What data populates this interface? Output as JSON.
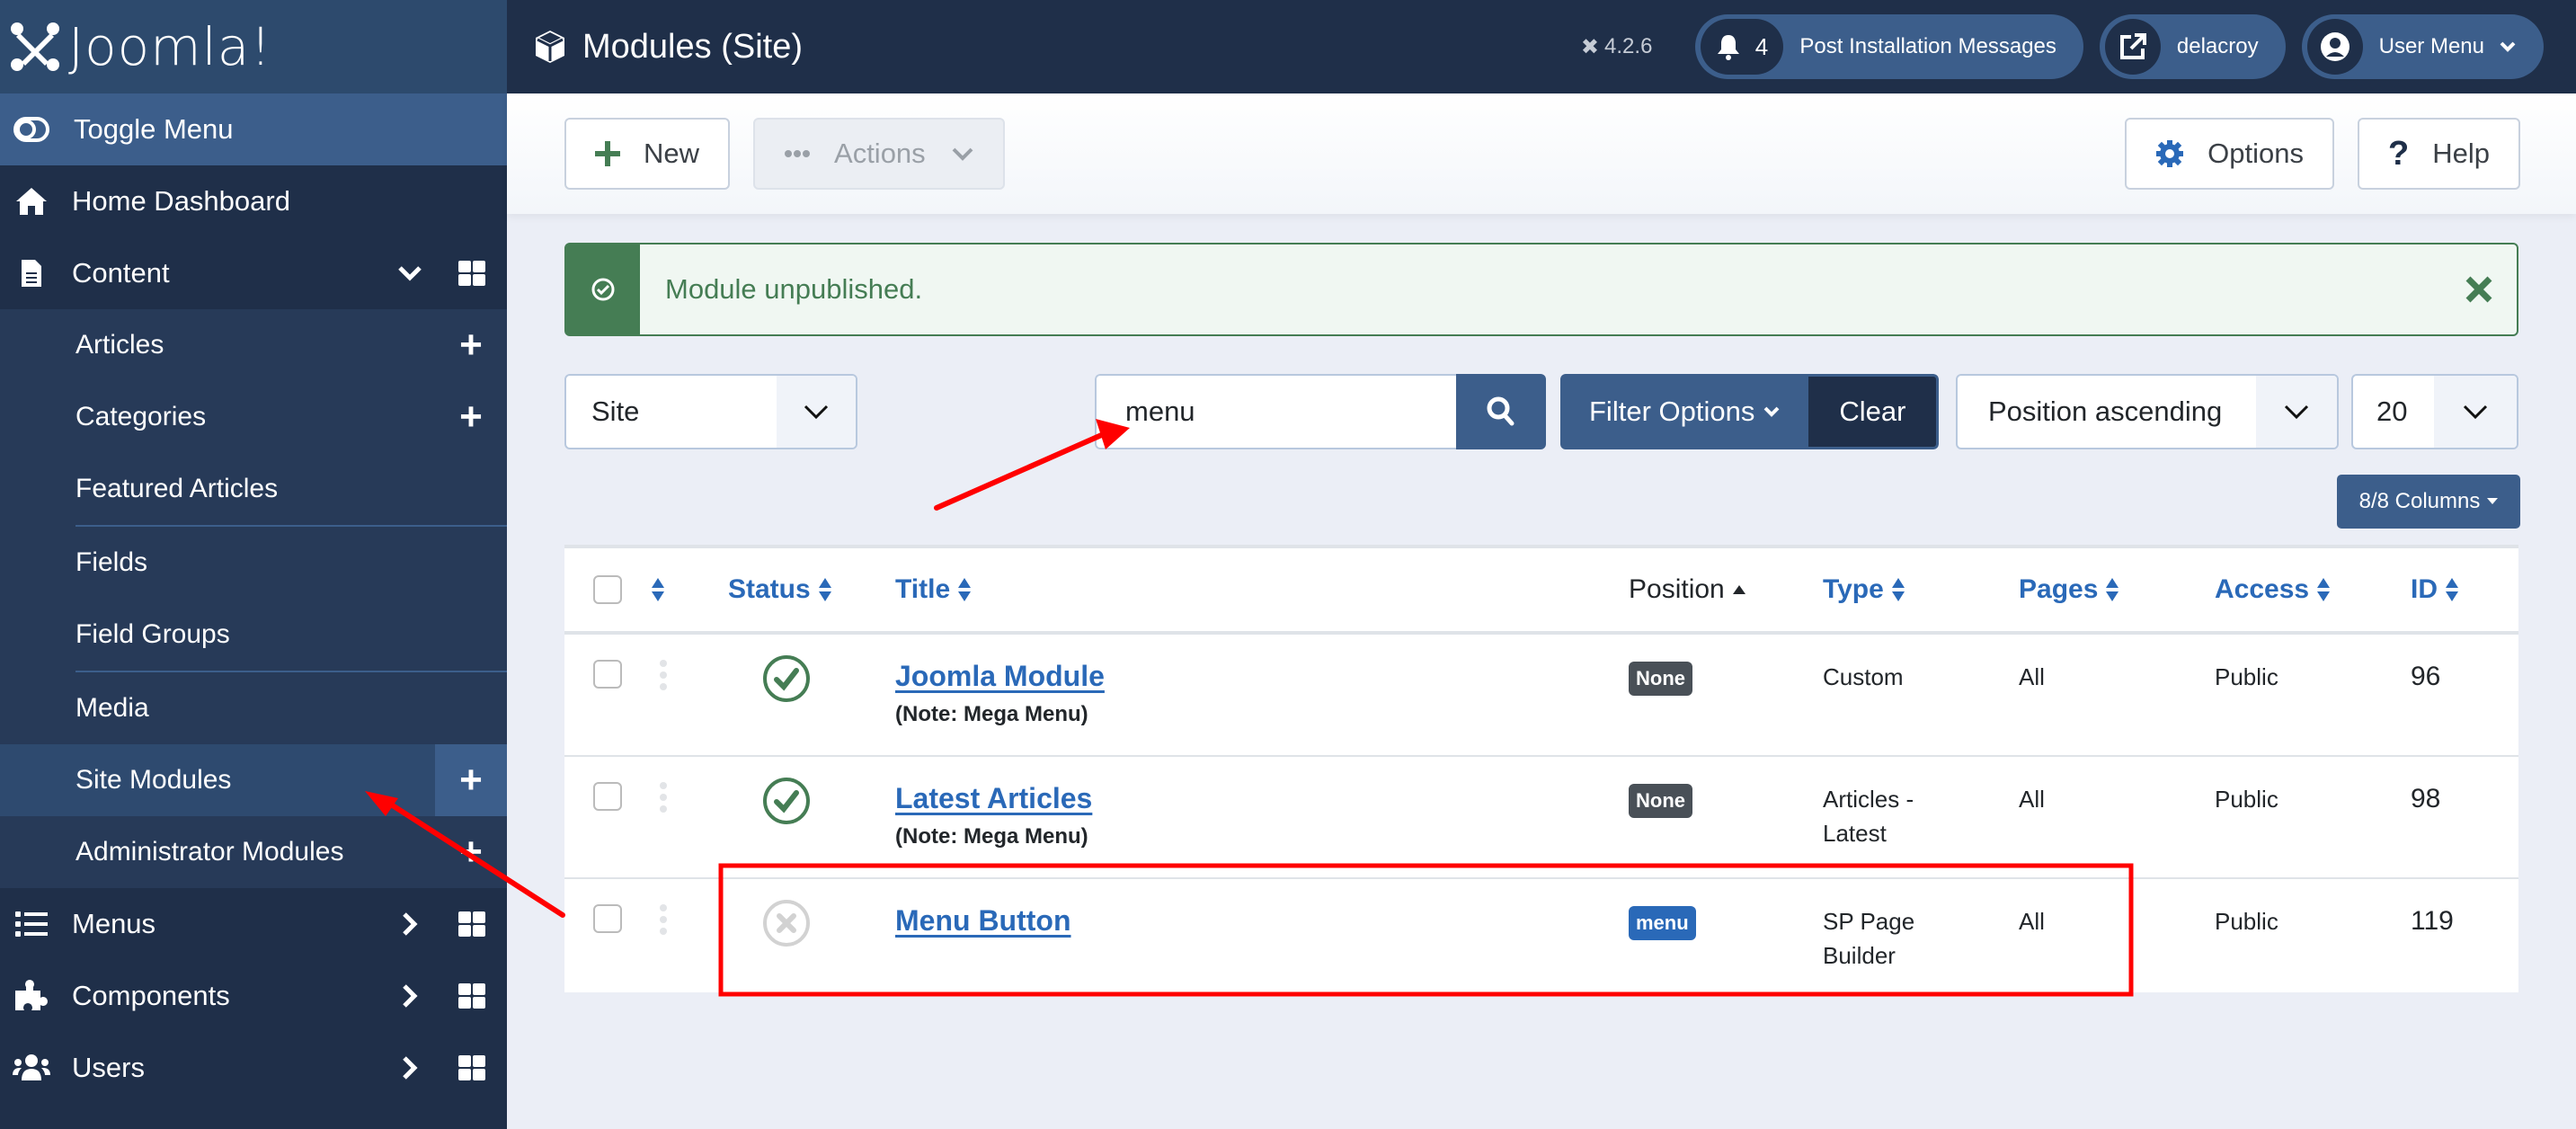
{
  "app": {
    "brand": "Joomla!",
    "version": "4.2.6"
  },
  "header": {
    "title": "Modules (Site)",
    "notifications_count": "4",
    "notifications_label": "Post Installation Messages",
    "site_link_label": "delacroy",
    "user_menu_label": "User Menu"
  },
  "sidebar": {
    "toggle_label": "Toggle Menu",
    "home_label": "Home Dashboard",
    "content_label": "Content",
    "content_items": [
      {
        "label": "Articles",
        "has_add": true
      },
      {
        "label": "Categories",
        "has_add": true
      },
      {
        "label": "Featured Articles",
        "has_add": false
      },
      {
        "label": "Fields",
        "has_add": false
      },
      {
        "label": "Field Groups",
        "has_add": false
      },
      {
        "label": "Media",
        "has_add": false
      },
      {
        "label": "Site Modules",
        "has_add": true,
        "active": true
      },
      {
        "label": "Administrator Modules",
        "has_add": true
      }
    ],
    "menus_label": "Menus",
    "components_label": "Components",
    "users_label": "Users"
  },
  "toolbar": {
    "new_label": "New",
    "actions_label": "Actions",
    "options_label": "Options",
    "help_label": "Help"
  },
  "alert": {
    "message": "Module unpublished.",
    "type": "success"
  },
  "filters": {
    "client_select": "Site",
    "search_value": "menu",
    "filter_options_label": "Filter Options",
    "clear_label": "Clear",
    "sort_select": "Position ascending",
    "limit_select": "20",
    "columns_label": "8/8 Columns"
  },
  "table": {
    "headers": {
      "status": "Status",
      "title": "Title",
      "position": "Position",
      "type": "Type",
      "pages": "Pages",
      "access": "Access",
      "id": "ID"
    },
    "rows": [
      {
        "status": "published",
        "title": "Joomla Module",
        "note": "(Note: Mega Menu)",
        "position": "None",
        "position_style": "none",
        "type": [
          "Custom"
        ],
        "pages": "All",
        "access": "Public",
        "id": "96"
      },
      {
        "status": "published",
        "title": "Latest Articles",
        "note": "(Note: Mega Menu)",
        "position": "None",
        "position_style": "none",
        "type": [
          "Articles -",
          "Latest"
        ],
        "pages": "All",
        "access": "Public",
        "id": "98"
      },
      {
        "status": "unpublished",
        "title": "Menu Button",
        "note": "",
        "position": "menu",
        "position_style": "menu",
        "type": [
          "SP Page",
          "Builder"
        ],
        "pages": "All",
        "access": "Public",
        "id": "119"
      }
    ]
  },
  "colors": {
    "sidebar_bg": "#1f2f49",
    "accent": "#3c5e8b",
    "link": "#2a69b8",
    "success": "#457d54",
    "annotation": "#ff0000"
  }
}
